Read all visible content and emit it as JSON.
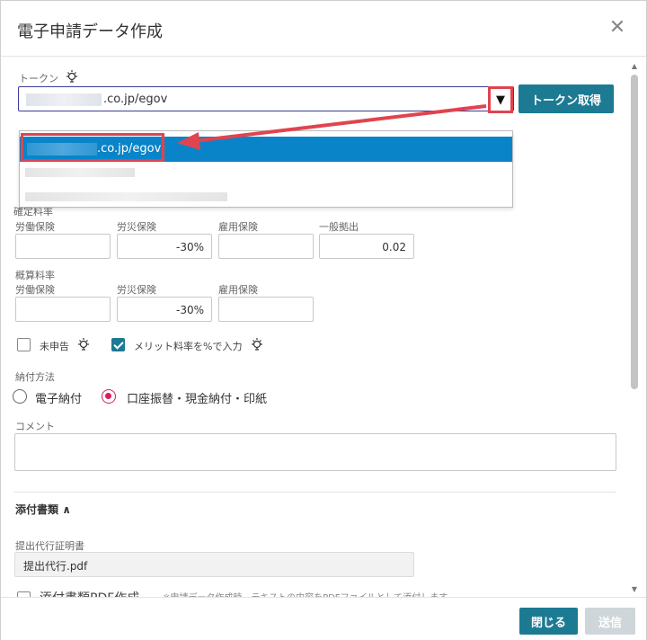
{
  "dialog": {
    "title": "電子申請データ作成",
    "close_icon": "close-icon"
  },
  "token": {
    "label": "トークン",
    "selected_value_suffix": ".co.jp/egov",
    "button_label": "トークン取得",
    "dropdown_arrow": "▼",
    "options": [
      {
        "suffix": ".co.jp/egov",
        "selected": true
      }
    ]
  },
  "confirmed_rate": {
    "label": "確定料率",
    "fields": [
      {
        "label": "労働保険",
        "value": ""
      },
      {
        "label": "労災保険",
        "value": "-30%"
      },
      {
        "label": "雇用保険",
        "value": ""
      },
      {
        "label": "一般拠出",
        "value": "0.02"
      }
    ]
  },
  "estimated_rate": {
    "label": "概算料率",
    "fields": [
      {
        "label": "労働保険",
        "value": ""
      },
      {
        "label": "労災保険",
        "value": "-30%"
      },
      {
        "label": "雇用保険",
        "value": ""
      }
    ]
  },
  "checkboxes": {
    "unreported": {
      "label": "未申告",
      "checked": false
    },
    "merit_rate": {
      "label": "メリット料率を%で入力",
      "checked": true
    }
  },
  "payment": {
    "label": "納付方法",
    "options": [
      {
        "label": "電子納付",
        "selected": false
      },
      {
        "label": "口座振替・現金納付・印紙",
        "selected": true
      }
    ]
  },
  "comment": {
    "label": "コメント",
    "value": ""
  },
  "attachments": {
    "section_title": "添付書類",
    "proxy_cert_label": "提出代行証明書",
    "proxy_cert_file": "提出代行.pdf",
    "pdf_create_label": "添付書類PDF作成",
    "pdf_create_note": "※申請データ作成時、テキストの内容をPDFファイルとして添付します"
  },
  "footer": {
    "close_label": "閉じる",
    "send_label": "送信"
  },
  "colors": {
    "primary": "#1d7a93",
    "highlight_red": "#e0444f",
    "selected_blue": "#0a84c9",
    "radio_accent": "#d91e5b",
    "disabled": "#cfd6da"
  }
}
